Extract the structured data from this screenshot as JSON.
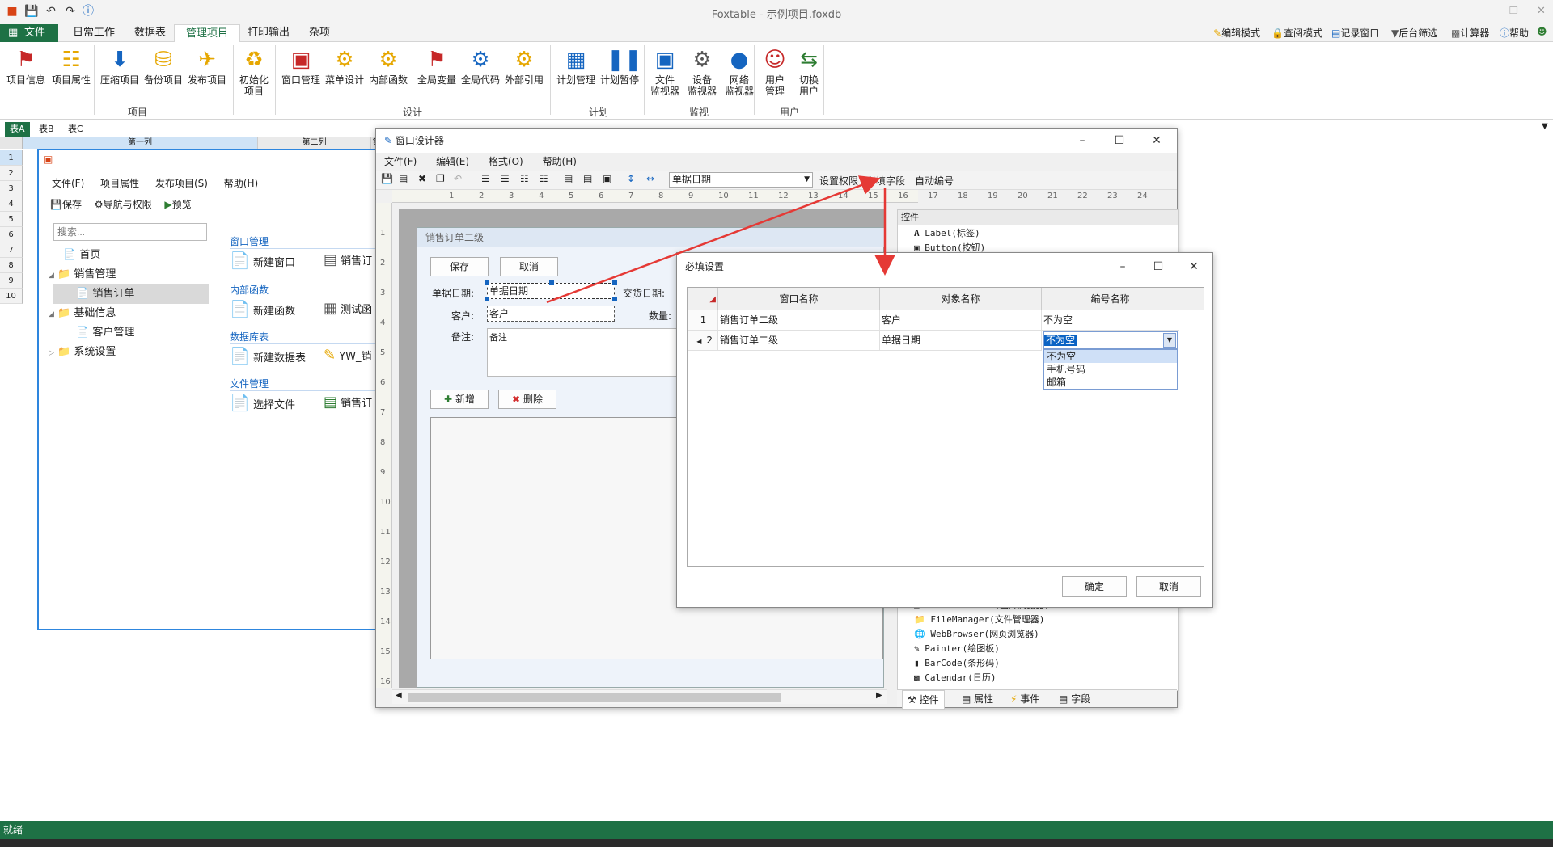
{
  "app": {
    "title": "Foxtable - 示例项目.foxdb",
    "status": "就绪"
  },
  "ribbon_tabs": [
    {
      "label": "文件"
    },
    {
      "label": "日常工作"
    },
    {
      "label": "数据表"
    },
    {
      "label": "管理项目"
    },
    {
      "label": "打印输出"
    },
    {
      "label": "杂项"
    }
  ],
  "top_right": {
    "edit_mode": "编辑模式",
    "query_mode": "查阅模式",
    "record_window": "记录窗口",
    "backend_filter": "后台筛选",
    "calculator": "计算器",
    "help": "帮助"
  },
  "ribbon": {
    "buttons": [
      {
        "label": "项目信息"
      },
      {
        "label": "项目属性"
      },
      {
        "label": "压缩项目"
      },
      {
        "label": "备份项目"
      },
      {
        "label": "发布项目"
      },
      {
        "label": "初始化",
        "label2": "项目"
      },
      {
        "label": "窗口管理"
      },
      {
        "label": "菜单设计"
      },
      {
        "label": "内部函数"
      },
      {
        "label": "全局变量"
      },
      {
        "label": "全局代码"
      },
      {
        "label": "外部引用"
      },
      {
        "label": "计划管理"
      },
      {
        "label": "计划暂停"
      },
      {
        "label": "文件",
        "label2": "监视器"
      },
      {
        "label": "设备",
        "label2": "监视器"
      },
      {
        "label": "网络",
        "label2": "监视器"
      },
      {
        "label": "用户",
        "label2": "管理"
      },
      {
        "label": "切换",
        "label2": "用户"
      }
    ],
    "groups": [
      "项目",
      "设计",
      "计划",
      "监视",
      "用户"
    ]
  },
  "sheet_tabs": [
    "表A",
    "表B",
    "表C"
  ],
  "grid": {
    "col1": "第一列",
    "col2": "第二列",
    "col3": "第三",
    "rows": [
      "1",
      "2",
      "3",
      "4",
      "5",
      "6",
      "7",
      "8",
      "9",
      "10"
    ]
  },
  "nav_window": {
    "menu": [
      "文件(F)",
      "项目属性",
      "发布项目(S)",
      "帮助(H)"
    ],
    "toolbar": [
      "保存",
      "导航与权限",
      "预览"
    ],
    "search_placeholder": "搜索...",
    "tree": [
      {
        "label": "首页"
      },
      {
        "label": "销售管理"
      },
      {
        "label": "销售订单"
      },
      {
        "label": "基础信息"
      },
      {
        "label": "客户管理"
      },
      {
        "label": "系统设置"
      }
    ],
    "sections": [
      {
        "title": "窗口管理",
        "items": [
          "新建窗口",
          "销售订"
        ]
      },
      {
        "title": "内部函数",
        "items": [
          "新建函数",
          "测试函"
        ]
      },
      {
        "title": "数据库表",
        "items": [
          "新建数据表",
          "YW_销"
        ]
      },
      {
        "title": "文件管理",
        "items": [
          "选择文件",
          "销售订"
        ]
      }
    ]
  },
  "designer": {
    "title": "窗口设计器",
    "menu": [
      "文件(F)",
      "编辑(E)",
      "格式(O)",
      "帮助(H)"
    ],
    "combo": "单据日期",
    "links": [
      "设置权限",
      "必填字段",
      "自动编号"
    ],
    "ruler_top": [
      "1",
      "2",
      "3",
      "4",
      "5",
      "6",
      "7",
      "8",
      "9",
      "10",
      "11",
      "12",
      "13",
      "14",
      "15",
      "16",
      "17",
      "18",
      "19",
      "20",
      "21",
      "22",
      "23",
      "24"
    ],
    "ruler_left": [
      "1",
      "2",
      "3",
      "4",
      "5",
      "6",
      "7",
      "8",
      "9",
      "10",
      "11",
      "12",
      "13",
      "14",
      "15",
      "16"
    ],
    "form": {
      "title": "销售订单二级",
      "save": "保存",
      "cancel": "取消",
      "date_label": "单据日期:",
      "date_value": "单据日期",
      "delivery_label": "交货日期:",
      "customer_label": "客户:",
      "customer_value": "客户",
      "qty_label": "数量:",
      "note_label": "备注:",
      "note_value": "备注",
      "add": "新增",
      "delete": "删除"
    },
    "controls_panel": {
      "title": "控件",
      "items_top": [
        "Label(标签)",
        "Button(按钮)"
      ],
      "items_bottom": [
        "PictureViewer(图片浏览器)",
        "FileManager(文件管理器)",
        "WebBrowser(网页浏览器)",
        "Painter(绘图板)",
        "BarCode(条形码)",
        "Calendar(日历)"
      ],
      "tabs": [
        "控件",
        "属性",
        "事件",
        "字段"
      ]
    }
  },
  "required_dialog": {
    "title": "必填设置",
    "columns": [
      "窗口名称",
      "对象名称",
      "编号名称"
    ],
    "rows": [
      {
        "num": "1",
        "window": "销售订单二级",
        "object": "客户",
        "rule": "不为空"
      },
      {
        "num": "2",
        "window": "销售订单二级",
        "object": "单据日期",
        "rule": "不为空"
      }
    ],
    "dropdown_options": [
      "不为空",
      "手机号码",
      "邮箱"
    ],
    "ok": "确定",
    "cancel": "取消"
  },
  "colors": {
    "brand": "#1e7145",
    "accent": "#0b63c4",
    "arrow": "#e53935"
  }
}
